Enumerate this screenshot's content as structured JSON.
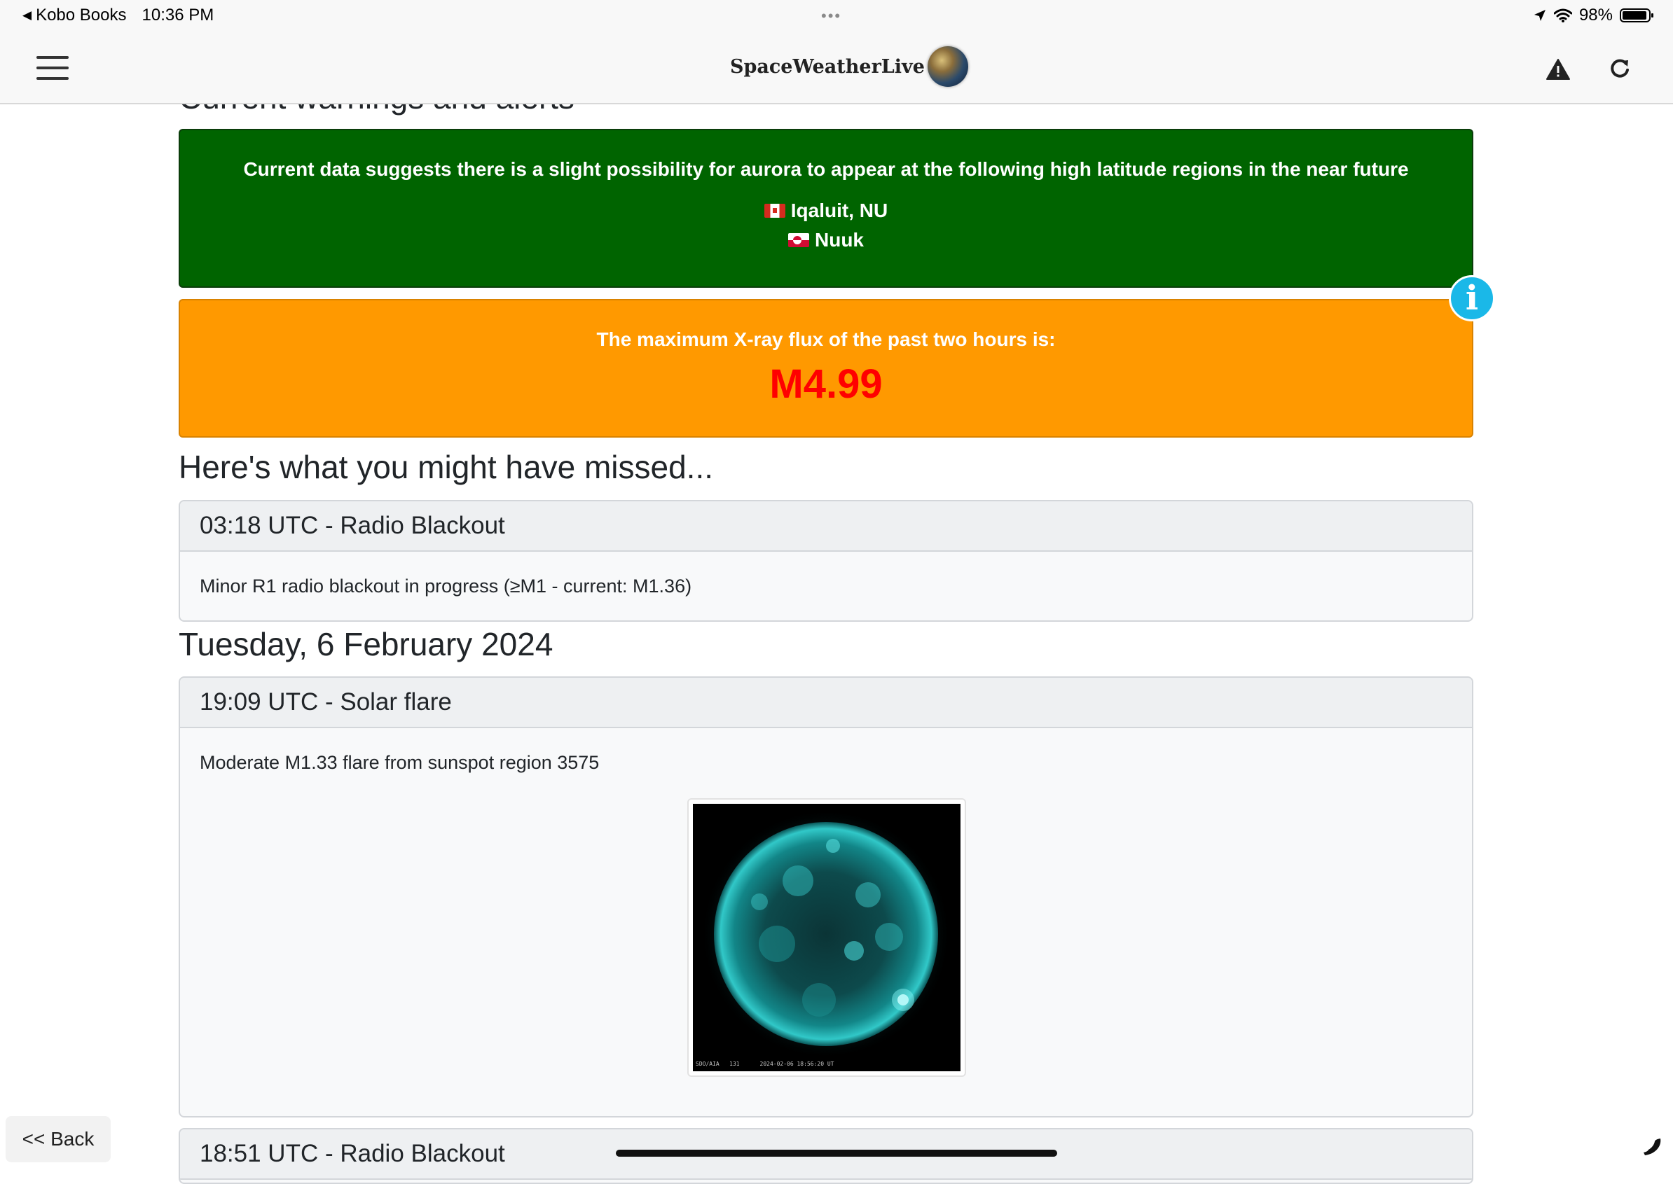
{
  "status_bar": {
    "back_app": "Kobo Books",
    "time": "10:36 PM",
    "dots": "•••",
    "battery": "98%"
  },
  "header": {
    "logo_text": "SpaceWeatherLive"
  },
  "page": {
    "cut_heading": "Current warnings and alerts",
    "aurora_alert": {
      "message": "Current data suggests there is a slight possibility for aurora to appear at the following high latitude regions in the near future",
      "locations": [
        "Iqaluit, NU",
        "Nuuk"
      ]
    },
    "info_icon_glyph": "i",
    "xray_alert": {
      "message": "The maximum X-ray flux of the past two hours is:",
      "value": "M4.99"
    },
    "missed_heading": "Here's what you might have missed...",
    "date_heading": "Tuesday, 6 February 2024",
    "events": [
      {
        "header": "03:18 UTC - Radio Blackout",
        "body": "Minor R1 radio blackout in progress (≥M1 - current: M1.36)"
      },
      {
        "header": "19:09 UTC - Solar flare",
        "body": "Moderate M1.33 flare from sunspot region 3575",
        "image_caption": "SDO/AIA   131      2024-02-06 18:56:20 UT"
      },
      {
        "header": "18:51 UTC - Radio Blackout"
      }
    ]
  },
  "back_button": "<< Back",
  "colors": {
    "aurora_green": "#006400",
    "xray_orange": "#ff9900",
    "flux_red": "#ff0000",
    "info_blue": "#1ab8e8"
  }
}
